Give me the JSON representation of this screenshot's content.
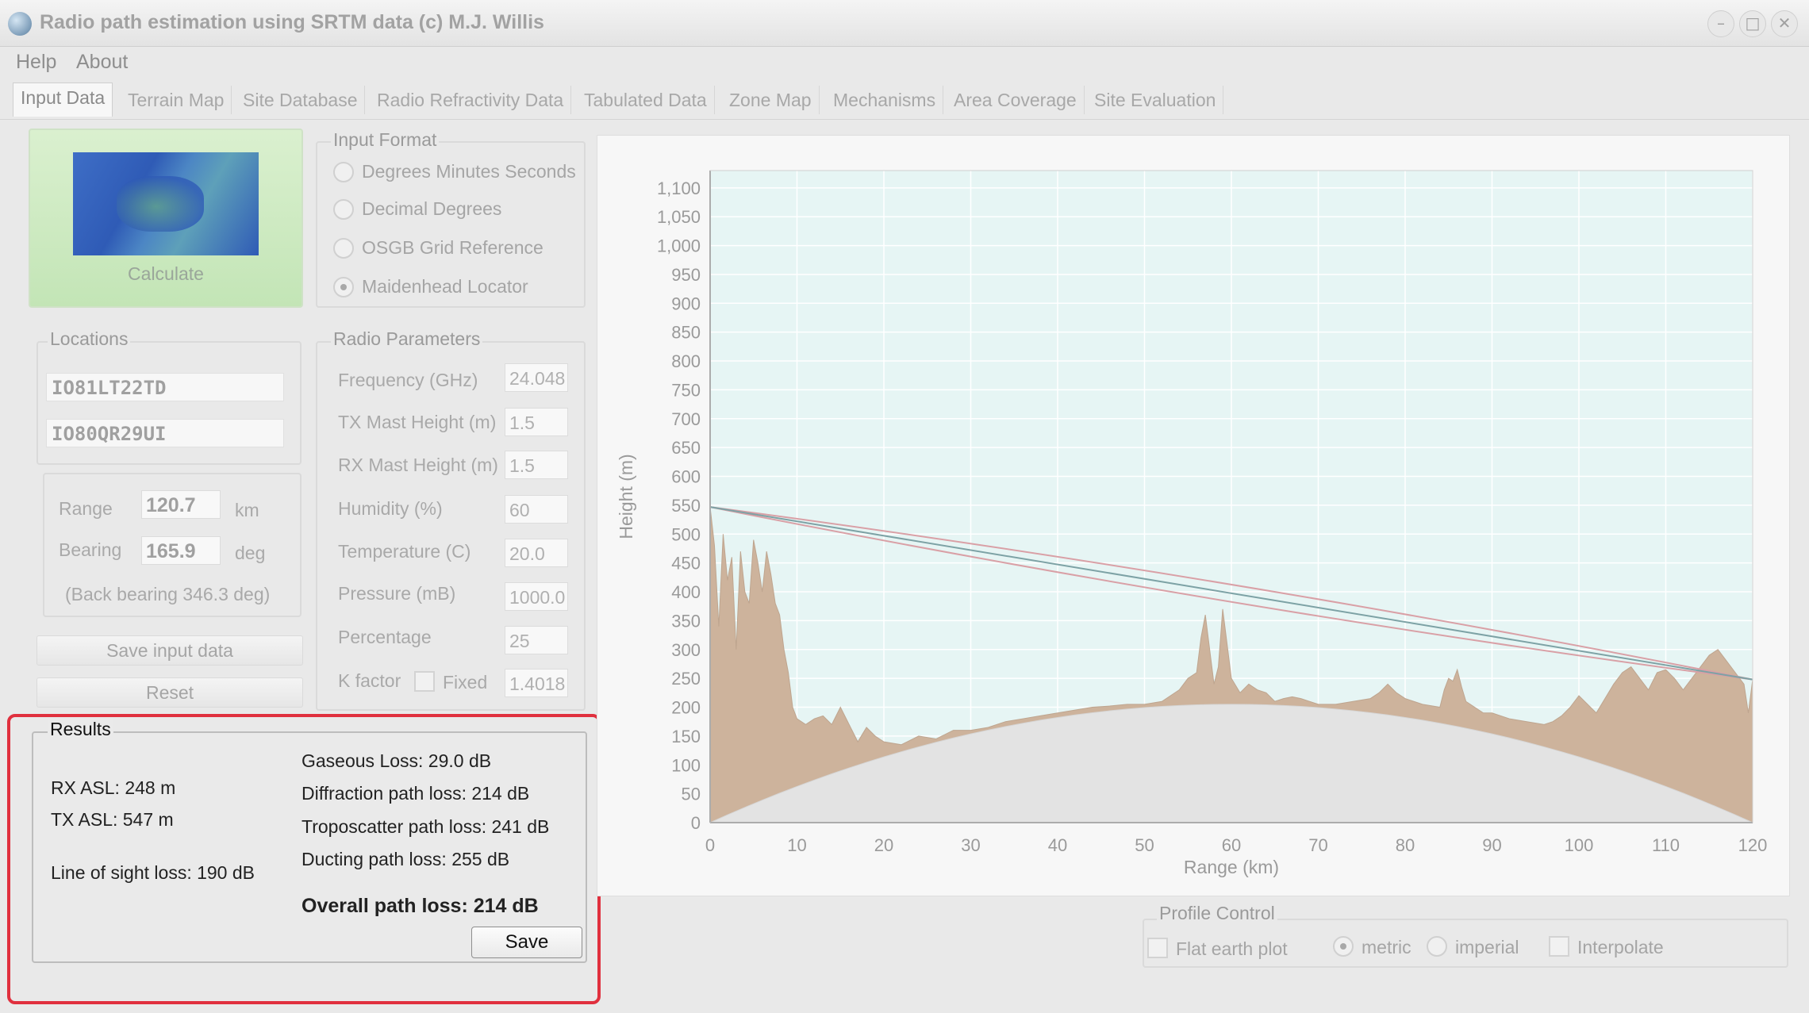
{
  "window": {
    "title": "Radio path estimation using SRTM data (c) M.J. Willis"
  },
  "menu": [
    "Help",
    "About"
  ],
  "tabs": [
    "Input Data",
    "Terrain Map",
    "Site Database",
    "Radio Refractivity Data",
    "Tabulated Data",
    "Zone Map",
    "Mechanisms",
    "Area Coverage",
    "Site Evaluation"
  ],
  "calculate": {
    "label": "Calculate"
  },
  "input_format": {
    "title": "Input Format",
    "options": [
      "Degrees Minutes Seconds",
      "Decimal Degrees",
      "OSGB Grid Reference",
      "Maidenhead Locator"
    ],
    "selected": "Maidenhead Locator"
  },
  "locations": {
    "title": "Locations",
    "loc1": "IO81LT22TD",
    "loc2": "IO80QR29UI",
    "range_label": "Range",
    "range_value": "120.7",
    "range_unit": "km",
    "bearing_label": "Bearing",
    "bearing_value": "165.9",
    "bearing_unit": "deg",
    "back_bearing": "(Back bearing 346.3 deg)"
  },
  "buttons": {
    "save_input": "Save input data",
    "reset": "Reset"
  },
  "radio_params": {
    "title": "Radio Parameters",
    "frequency_label": "Frequency (GHz)",
    "frequency": "24.048",
    "tx_mast_label": "TX Mast Height (m)",
    "tx_mast": "1.5",
    "rx_mast_label": "RX Mast Height (m)",
    "rx_mast": "1.5",
    "humidity_label": "Humidity (%)",
    "humidity": "60",
    "temperature_label": "Temperature (C)",
    "temperature": "20.0",
    "pressure_label": "Pressure (mB)",
    "pressure": "1000.0",
    "percentage_label": "Percentage",
    "percentage": "25",
    "kfactor_label": "K factor",
    "fixed_label": "Fixed",
    "kfactor": "1.4018"
  },
  "results": {
    "title": "Results",
    "rx_asl": "RX ASL: 248 m",
    "tx_asl": "TX ASL: 547 m",
    "los_loss": "Line of sight loss: 190 dB",
    "gaseous_loss": "Gaseous Loss: 29.0 dB",
    "diffraction_loss": "Diffraction path loss: 214 dB",
    "troposcatter_loss": "Troposcatter path loss: 241 dB",
    "ducting_loss": "Ducting path loss: 255 dB",
    "overall_loss": "Overall path loss: 214 dB",
    "save_label": "Save"
  },
  "profile_control": {
    "title": "Profile Control",
    "flat_earth": "Flat earth plot",
    "metric": "metric",
    "imperial": "imperial",
    "interpolate": "Interpolate",
    "units_selected": "metric"
  },
  "colors": {
    "plot_bg": "#e6f5f4",
    "terrain": "#cdb39c",
    "earth_bulge": "#e3e3e3",
    "los_line": "#7da2a5",
    "fresnel": "#d9a0a6",
    "highlight": "#e0303e"
  },
  "chart_data": {
    "type": "area",
    "xlabel": "Range (km)",
    "ylabel": "Height (m)",
    "xlim": [
      0,
      120
    ],
    "ylim": [
      0,
      1130
    ],
    "x_ticks": [
      0,
      10,
      20,
      30,
      40,
      50,
      60,
      70,
      80,
      90,
      100,
      110,
      120
    ],
    "y_ticks": [
      0,
      50,
      100,
      150,
      200,
      250,
      300,
      350,
      400,
      450,
      500,
      550,
      600,
      650,
      700,
      750,
      800,
      850,
      900,
      950,
      1000,
      1050,
      1100
    ],
    "y_tick_labels": [
      "0",
      "50",
      "100",
      "150",
      "200",
      "250",
      "300",
      "350",
      "400",
      "450",
      "500",
      "550",
      "600",
      "650",
      "700",
      "750",
      "800",
      "850",
      "900",
      "950",
      "1,000",
      "1,050",
      "1,100"
    ],
    "grid": true,
    "series": [
      {
        "x": [
          0,
          0.5,
          1,
          1.5,
          2,
          2.5,
          3,
          3.5,
          4,
          4.5,
          5,
          5.5,
          6,
          6.5,
          7,
          7.5,
          8,
          8.5,
          9,
          9.5,
          10,
          11,
          12,
          13,
          14,
          15,
          16,
          17,
          18,
          19,
          20,
          22,
          24,
          26,
          28,
          30,
          32,
          34,
          36,
          38,
          40,
          42,
          44,
          46,
          48,
          50,
          52,
          54,
          55,
          56,
          56.5,
          57,
          57.5,
          58,
          58.5,
          59,
          60,
          61,
          62,
          63,
          64,
          65,
          66,
          67,
          68,
          70,
          72,
          74,
          76,
          77,
          78,
          79,
          80,
          82,
          84,
          84.5,
          85,
          85.5,
          86,
          86.5,
          87,
          88,
          89,
          90,
          92,
          94,
          96,
          97,
          98,
          99,
          100,
          101,
          102,
          103,
          104,
          105,
          106,
          107,
          108,
          109,
          110,
          111,
          112,
          113,
          114,
          115,
          116,
          117,
          118,
          119,
          119.5,
          120
        ],
        "y": [
          547,
          480,
          340,
          500,
          420,
          460,
          300,
          470,
          400,
          380,
          490,
          450,
          400,
          470,
          430,
          380,
          360,
          300,
          260,
          200,
          180,
          170,
          180,
          185,
          170,
          200,
          170,
          140,
          165,
          150,
          140,
          135,
          150,
          145,
          160,
          160,
          165,
          175,
          180,
          185,
          190,
          195,
          200,
          202,
          205,
          205,
          210,
          230,
          250,
          260,
          320,
          360,
          300,
          240,
          270,
          370,
          250,
          225,
          240,
          230,
          225,
          210,
          215,
          218,
          215,
          205,
          205,
          210,
          215,
          225,
          240,
          225,
          215,
          205,
          200,
          230,
          250,
          245,
          265,
          235,
          210,
          200,
          190,
          190,
          180,
          175,
          170,
          175,
          185,
          200,
          220,
          205,
          190,
          215,
          240,
          260,
          270,
          250,
          230,
          260,
          265,
          250,
          230,
          250,
          270,
          290,
          300,
          280,
          260,
          240,
          190,
          248
        ],
        "name": ""
      }
    ]
  }
}
